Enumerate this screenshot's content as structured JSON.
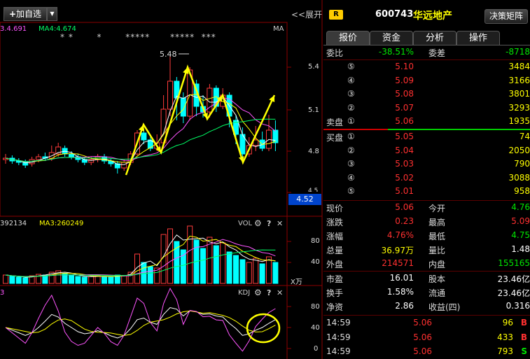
{
  "left_panel": {
    "add_watchlist_label": "加自选",
    "dropdown_glyph": "▼",
    "expand_label": "<<展开",
    "ma_line": {
      "ma3": "3.4.691",
      "ma4": "MA4:4.674",
      "ma_tag": "MA"
    },
    "star_marks": "* *       *       *****      *****  ***",
    "price_marker": "5.48",
    "price_axis": [
      "5.4",
      "5.1",
      "4.8"
    ],
    "price_axis_fraction": "4.5",
    "current_price_tag": "4.52",
    "vol_header": {
      "left": "392134",
      "ma3": "MA3:260249",
      "name": "VOL"
    },
    "vol_axis": [
      "80",
      "40"
    ],
    "vol_unit": "X万",
    "kdj_header": {
      "left": "3",
      "name": "KDJ"
    },
    "kdj_axis": [
      "80",
      "40",
      "0"
    ],
    "panel_controls": {
      "gear": "gear-icon",
      "help": "?",
      "close": "✕"
    }
  },
  "quote": {
    "r_badge": "R",
    "code": "600743",
    "name": "华远地产",
    "decision_button": "决策矩阵",
    "tabs": [
      "报价",
      "资金",
      "分析",
      "操作"
    ],
    "wei_bi": {
      "label": "委比",
      "value": "-38.51%",
      "label2": "委差",
      "value2": "-8718"
    },
    "sell": [
      {
        "idx": "⑤",
        "price": "5.10",
        "vol": "3484"
      },
      {
        "idx": "④",
        "price": "5.09",
        "vol": "3166"
      },
      {
        "idx": "③",
        "price": "5.08",
        "vol": "3801"
      },
      {
        "idx": "②",
        "price": "5.07",
        "vol": "3293"
      },
      {
        "idx": "①",
        "price": "5.06",
        "vol": "1935"
      }
    ],
    "sell_label": "卖盘",
    "buy_label": "买盘",
    "buy": [
      {
        "idx": "①",
        "price": "5.05",
        "vol": "74"
      },
      {
        "idx": "②",
        "price": "5.04",
        "vol": "2050"
      },
      {
        "idx": "③",
        "price": "5.03",
        "vol": "790"
      },
      {
        "idx": "④",
        "price": "5.02",
        "vol": "3088"
      },
      {
        "idx": "⑤",
        "price": "5.01",
        "vol": "958"
      }
    ],
    "stats1": [
      {
        "l1": "现价",
        "v1": "5.06",
        "c1": "red",
        "l2": "今开",
        "v2": "4.76",
        "c2": "grn"
      },
      {
        "l1": "涨跌",
        "v1": "0.23",
        "c1": "red",
        "l2": "最高",
        "v2": "5.09",
        "c2": "red"
      },
      {
        "l1": "涨幅",
        "v1": "4.76%",
        "c1": "red",
        "l2": "最低",
        "v2": "4.75",
        "c2": "grn"
      },
      {
        "l1": "总量",
        "v1": "36.97万",
        "c1": "yel",
        "l2": "量比",
        "v2": "1.48",
        "c2": "wht"
      },
      {
        "l1": "外盘",
        "v1": "214571",
        "c1": "red",
        "l2": "内盘",
        "v2": "155165",
        "c2": "grn"
      }
    ],
    "stats2": [
      {
        "l1": "市盈",
        "v1": "16.01",
        "l2": "股本",
        "v2": "23.46亿"
      },
      {
        "l1": "换手",
        "v1": "1.58%",
        "l2": "流通",
        "v2": "23.46亿"
      },
      {
        "l1": "净资",
        "v1": "2.86",
        "l2": "收益(四)",
        "v2": "0.316"
      }
    ],
    "trades": [
      {
        "time": "14:59",
        "price": "5.06",
        "vol": "96",
        "side": "B"
      },
      {
        "time": "14:59",
        "price": "5.06",
        "vol": "433",
        "side": "B"
      },
      {
        "time": "14:59",
        "price": "5.06",
        "vol": "793",
        "side": "S"
      }
    ]
  }
}
